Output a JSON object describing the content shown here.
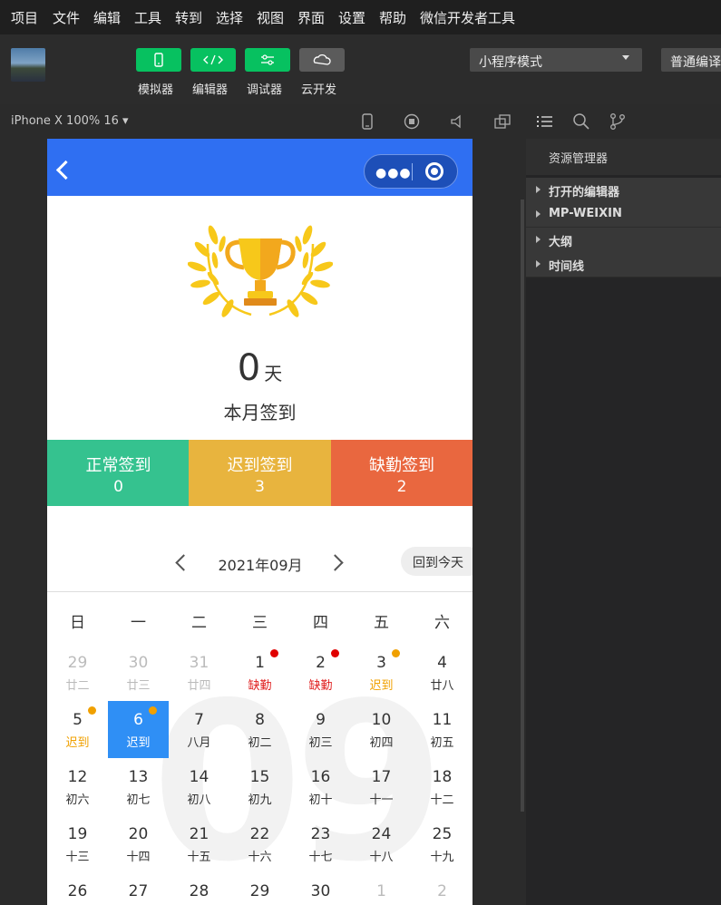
{
  "menu": [
    "项目",
    "文件",
    "编辑",
    "工具",
    "转到",
    "选择",
    "视图",
    "界面",
    "设置",
    "帮助",
    "微信开发者工具"
  ],
  "toolbar": {
    "buttons": [
      {
        "label": "模拟器",
        "color": "#07c160",
        "icon": "phone-icon"
      },
      {
        "label": "编辑器",
        "color": "#07c160",
        "icon": "code-icon"
      },
      {
        "label": "调试器",
        "color": "#07c160",
        "icon": "sliders-icon"
      },
      {
        "label": "云开发",
        "color": "#5b5b5b",
        "icon": "cloud-icon"
      }
    ],
    "mode": "小程序模式",
    "compile": "普通编译"
  },
  "simulator": {
    "device": "iPhone X 100% 16 ▾"
  },
  "page": {
    "days": "0",
    "days_unit": "天",
    "title": "本月签到",
    "stats": [
      {
        "label": "正常签到",
        "value": "0",
        "color": "#35c28f"
      },
      {
        "label": "迟到签到",
        "value": "3",
        "color": "#e8b43e"
      },
      {
        "label": "缺勤签到",
        "value": "2",
        "color": "#e9673f"
      }
    ],
    "calendar": {
      "month": "2021年09月",
      "today_btn": "回到今天",
      "watermark": "09",
      "weekdays": [
        "日",
        "一",
        "二",
        "三",
        "四",
        "五",
        "六"
      ],
      "rows": [
        [
          {
            "d": "29",
            "s": "廿二",
            "type": "other"
          },
          {
            "d": "30",
            "s": "廿三",
            "type": "other"
          },
          {
            "d": "31",
            "s": "廿四",
            "type": "other"
          },
          {
            "d": "1",
            "s": "缺勤",
            "type": "absent",
            "dot": "#e00000"
          },
          {
            "d": "2",
            "s": "缺勤",
            "type": "absent",
            "dot": "#e00000"
          },
          {
            "d": "3",
            "s": "迟到",
            "type": "late",
            "dot": "#f0a000"
          },
          {
            "d": "4",
            "s": "廿八",
            "type": "normal"
          }
        ],
        [
          {
            "d": "5",
            "s": "迟到",
            "type": "late",
            "dot": "#f0a000"
          },
          {
            "d": "6",
            "s": "迟到",
            "type": "selected",
            "dot": "#f0a000"
          },
          {
            "d": "7",
            "s": "八月",
            "type": "normal"
          },
          {
            "d": "8",
            "s": "初二",
            "type": "normal"
          },
          {
            "d": "9",
            "s": "初三",
            "type": "normal"
          },
          {
            "d": "10",
            "s": "初四",
            "type": "normal"
          },
          {
            "d": "11",
            "s": "初五",
            "type": "normal"
          }
        ],
        [
          {
            "d": "12",
            "s": "初六",
            "type": "normal"
          },
          {
            "d": "13",
            "s": "初七",
            "type": "normal"
          },
          {
            "d": "14",
            "s": "初八",
            "type": "normal"
          },
          {
            "d": "15",
            "s": "初九",
            "type": "normal"
          },
          {
            "d": "16",
            "s": "初十",
            "type": "normal"
          },
          {
            "d": "17",
            "s": "十一",
            "type": "normal"
          },
          {
            "d": "18",
            "s": "十二",
            "type": "normal"
          }
        ],
        [
          {
            "d": "19",
            "s": "十三",
            "type": "normal"
          },
          {
            "d": "20",
            "s": "十四",
            "type": "normal"
          },
          {
            "d": "21",
            "s": "十五",
            "type": "normal"
          },
          {
            "d": "22",
            "s": "十六",
            "type": "normal"
          },
          {
            "d": "23",
            "s": "十七",
            "type": "normal"
          },
          {
            "d": "24",
            "s": "十八",
            "type": "normal"
          },
          {
            "d": "25",
            "s": "十九",
            "type": "normal"
          }
        ],
        [
          {
            "d": "26",
            "s": "",
            "type": "normal"
          },
          {
            "d": "27",
            "s": "",
            "type": "normal"
          },
          {
            "d": "28",
            "s": "",
            "type": "normal"
          },
          {
            "d": "29",
            "s": "",
            "type": "normal"
          },
          {
            "d": "30",
            "s": "",
            "type": "normal"
          },
          {
            "d": "1",
            "s": "",
            "type": "other"
          },
          {
            "d": "2",
            "s": "",
            "type": "other"
          }
        ]
      ]
    }
  },
  "explorer": {
    "title": "资源管理器",
    "sections": [
      "打开的编辑器",
      "MP-WEIXIN",
      "大纲",
      "时间线"
    ]
  },
  "colors": {
    "navbar": "#2f6ff2",
    "selected": "#2f8ff5",
    "late": "#f0a000",
    "absent": "#e02020",
    "other": "#bbbbbb"
  }
}
